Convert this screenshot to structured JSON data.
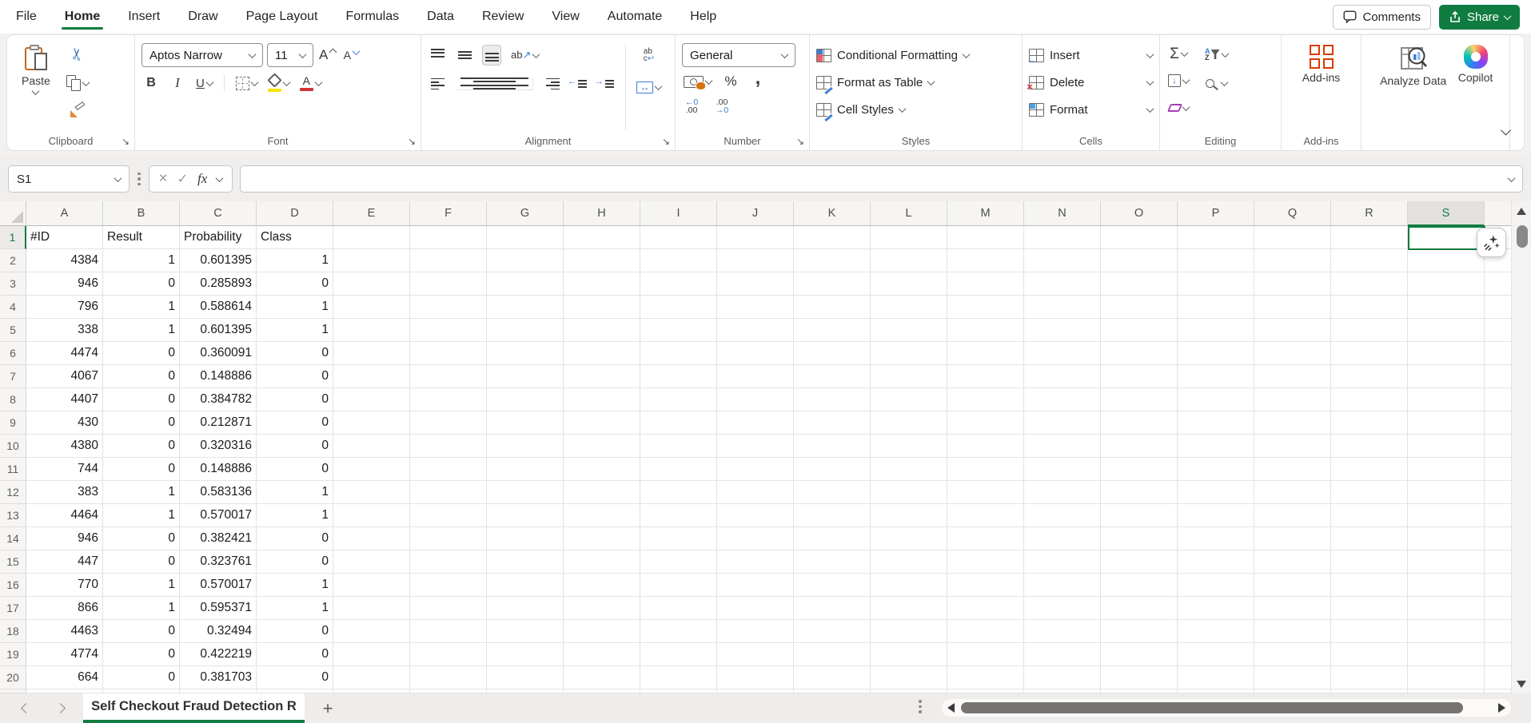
{
  "menu": {
    "tabs": [
      "File",
      "Home",
      "Insert",
      "Draw",
      "Page Layout",
      "Formulas",
      "Data",
      "Review",
      "View",
      "Automate",
      "Help"
    ],
    "active_tab": "Home",
    "comments_label": "Comments",
    "share_label": "Share"
  },
  "ribbon": {
    "clipboard": {
      "label": "Clipboard",
      "paste_label": "Paste"
    },
    "font": {
      "label": "Font",
      "font_name": "Aptos Narrow",
      "font_size": "11"
    },
    "alignment": {
      "label": "Alignment"
    },
    "number": {
      "label": "Number",
      "format": "General"
    },
    "styles": {
      "label": "Styles",
      "items": [
        "Conditional Formatting",
        "Format as Table",
        "Cell Styles"
      ]
    },
    "cells": {
      "label": "Cells",
      "items": [
        "Insert",
        "Delete",
        "Format"
      ]
    },
    "editing": {
      "label": "Editing"
    },
    "addins": {
      "label": "Add-ins",
      "button_label": "Add-ins"
    },
    "analyze_label": "Analyze Data",
    "copilot_label": "Copilot"
  },
  "icons": {
    "cut": "✂",
    "bold": "B",
    "italic": "I",
    "underline": "U",
    "grow_font": "A",
    "shrink_font": "A",
    "font_color_letter": "A",
    "sum": "Σ",
    "percent": "%",
    "comma": ",",
    "orient_ab": "ab",
    "orient_arrow": "↗",
    "wrap_ab": "ab",
    "wrap_c": "c",
    "wrap_arrow": "↩",
    "merge_arrow": "↔",
    "inc_dec_top": "←0",
    "inc_dec_bottom": ".00",
    "dec_dec_top": ".00",
    "dec_dec_bottom": "→0",
    "indent_left_arrow": "←",
    "indent_right_arrow": "→",
    "insert_arrow": "←",
    "delete_x": "×",
    "fill_down": "↓",
    "sort_a": "A",
    "sort_z": "Z",
    "cancel": "×",
    "enter": "✓",
    "fx": "fx",
    "launcher": "↘",
    "add_sheet": "+"
  },
  "formula_bar": {
    "name_box": "S1",
    "formula_value": ""
  },
  "grid": {
    "columns": [
      "A",
      "B",
      "C",
      "D",
      "E",
      "F",
      "G",
      "H",
      "I",
      "J",
      "K",
      "L",
      "M",
      "N",
      "O",
      "P",
      "Q",
      "R",
      "S"
    ],
    "selected_column": "S",
    "selected_row": 1,
    "selected_cell": "S1",
    "visible_rows": 20,
    "header_row": [
      "#ID",
      "Result",
      "Probability",
      "Class"
    ],
    "data_rows": [
      [
        "4384",
        "1",
        "0.601395",
        "1"
      ],
      [
        "946",
        "0",
        "0.285893",
        "0"
      ],
      [
        "796",
        "1",
        "0.588614",
        "1"
      ],
      [
        "338",
        "1",
        "0.601395",
        "1"
      ],
      [
        "4474",
        "0",
        "0.360091",
        "0"
      ],
      [
        "4067",
        "0",
        "0.148886",
        "0"
      ],
      [
        "4407",
        "0",
        "0.384782",
        "0"
      ],
      [
        "430",
        "0",
        "0.212871",
        "0"
      ],
      [
        "4380",
        "0",
        "0.320316",
        "0"
      ],
      [
        "744",
        "0",
        "0.148886",
        "0"
      ],
      [
        "383",
        "1",
        "0.583136",
        "1"
      ],
      [
        "4464",
        "1",
        "0.570017",
        "1"
      ],
      [
        "946",
        "0",
        "0.382421",
        "0"
      ],
      [
        "447",
        "0",
        "0.323761",
        "0"
      ],
      [
        "770",
        "1",
        "0.570017",
        "1"
      ],
      [
        "866",
        "1",
        "0.595371",
        "1"
      ],
      [
        "4463",
        "0",
        "0.32494",
        "0"
      ],
      [
        "4774",
        "0",
        "0.422219",
        "0"
      ],
      [
        "664",
        "0",
        "0.381703",
        "0"
      ]
    ]
  },
  "sheet_bar": {
    "active_sheet": "Self Checkout Fraud Detection R"
  },
  "colors": {
    "accent_green": "#107C41",
    "icon_blue": "#3b7dd8",
    "icon_red": "#d13438",
    "icon_orange": "#d9730d"
  }
}
